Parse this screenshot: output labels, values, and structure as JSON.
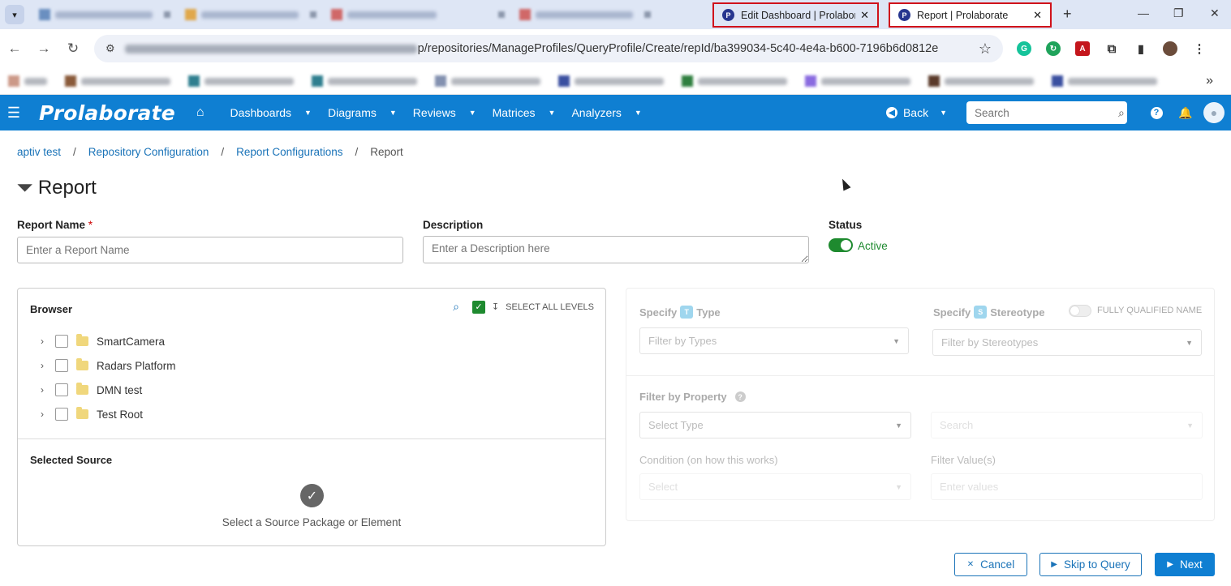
{
  "browser": {
    "tabs": [
      {
        "title": "Edit Dashboard | Prolaborate",
        "active": false
      },
      {
        "title": "Report | Prolaborate",
        "active": true
      }
    ],
    "tab_close": "✕",
    "new_tab": "+",
    "url": "p/repositories/ManageProfiles/QueryProfile/Create/repId/ba399034-5c40-4e4a-b600-7196b6d0812e",
    "more_bookmarks": "»"
  },
  "app": {
    "brand": "Prolaborate",
    "menu": [
      {
        "label": "Dashboards"
      },
      {
        "label": "Diagrams"
      },
      {
        "label": "Reviews"
      },
      {
        "label": "Matrices"
      },
      {
        "label": "Analyzers"
      }
    ],
    "back_label": "Back",
    "search_placeholder": "Search"
  },
  "breadcrumb": [
    {
      "label": "aptiv test"
    },
    {
      "label": "Repository Configuration"
    },
    {
      "label": "Report Configurations"
    },
    {
      "label": "Report"
    }
  ],
  "breadcrumb_sep": "/",
  "page": {
    "title": "Report",
    "report_name_label": "Report Name",
    "required_mark": "*",
    "report_name_placeholder": "Enter a Report Name",
    "description_label": "Description",
    "description_placeholder": "Enter a Description here",
    "status_label": "Status",
    "status_value": "Active"
  },
  "browser_panel": {
    "title": "Browser",
    "select_all_label": "SELECT ALL LEVELS",
    "tree": [
      {
        "label": "SmartCamera"
      },
      {
        "label": "Radars Platform"
      },
      {
        "label": "DMN test"
      },
      {
        "label": "Test Root"
      }
    ],
    "selected_title": "Selected Source",
    "selected_empty": "Select a Source Package or Element"
  },
  "filter_panel": {
    "specify": "Specify",
    "type_badge": "T",
    "type_label": "Type",
    "type_placeholder": "Filter by Types",
    "stereo_badge": "S",
    "stereo_label": "Stereotype",
    "stereo_placeholder": "Filter by Stereotypes",
    "fqn_label": "FULLY QUALIFIED NAME",
    "property_label": "Filter by Property",
    "select_type_placeholder": "Select Type",
    "search_placeholder": "Search",
    "condition_label": "Condition (on how this works)",
    "filter_values_label": "Filter Value(s)",
    "select_placeholder": "Select",
    "enter_values_placeholder": "Enter values"
  },
  "actions": {
    "cancel": "Cancel",
    "skip": "Skip to Query",
    "next": "Next"
  },
  "colors": {
    "brand_blue": "#0f7fd2",
    "active_green": "#1e8a2f",
    "highlight_red": "#d0121b"
  }
}
